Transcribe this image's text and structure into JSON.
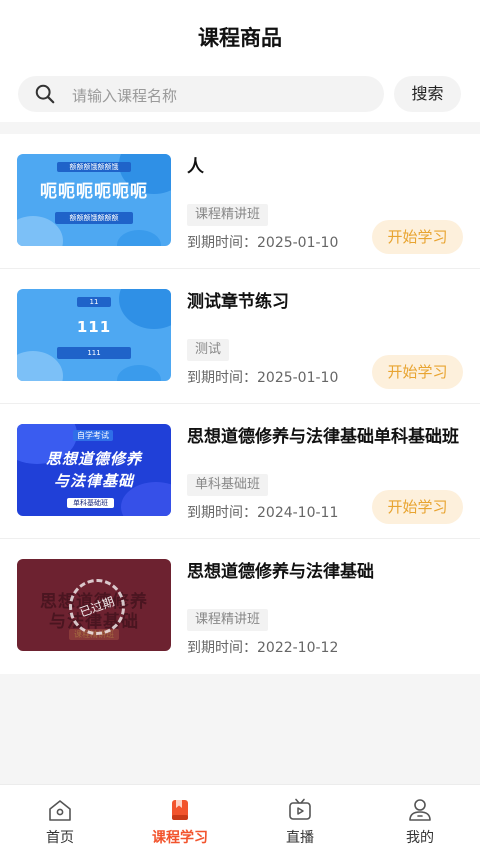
{
  "header": {
    "title": "课程商品"
  },
  "search": {
    "placeholder": "请输入课程名称",
    "button_label": "搜索"
  },
  "courses": [
    {
      "title": "人",
      "tag": "课程精讲班",
      "expire_label": "到期时间：",
      "expire_date": "2025-01-10",
      "action": "开始学习",
      "thumb": {
        "top": "额额额饿额额饿",
        "big": "呃呃呃呃呃呃",
        "bottom": "额额额饿额额额"
      }
    },
    {
      "title": "测试章节练习",
      "tag": "测试",
      "expire_label": "到期时间：",
      "expire_date": "2025-01-10",
      "action": "开始学习",
      "thumb": {
        "top": "11",
        "big": "111",
        "bottom": "111"
      }
    },
    {
      "title": "思想道德修养与法律基础单科基础班",
      "tag": "单科基础班",
      "expire_label": "到期时间：",
      "expire_date": "2024-10-11",
      "action": "开始学习",
      "thumb": {
        "top": "自学考试",
        "big1": "思想道德修养",
        "big2": "与法律基础",
        "bottom": "单科基础班"
      }
    },
    {
      "title": "思想道德修养与法律基础",
      "tag": "课程精讲班",
      "expire_label": "到期时间：",
      "expire_date": "2022-10-12",
      "thumb": {
        "big1": "思想道德修养",
        "big2": "与法律基础",
        "bottom": "课程精讲班",
        "stamp": "已过期"
      }
    }
  ],
  "tabbar": {
    "items": [
      {
        "label": "首页",
        "icon": "home-icon"
      },
      {
        "label": "课程学习",
        "icon": "book-icon",
        "active": true
      },
      {
        "label": "直播",
        "icon": "tv-icon"
      },
      {
        "label": "我的",
        "icon": "user-icon"
      }
    ]
  },
  "colors": {
    "accent": "#f2542d",
    "action_text": "#e8a431",
    "action_bg": "#fdf0dc"
  }
}
